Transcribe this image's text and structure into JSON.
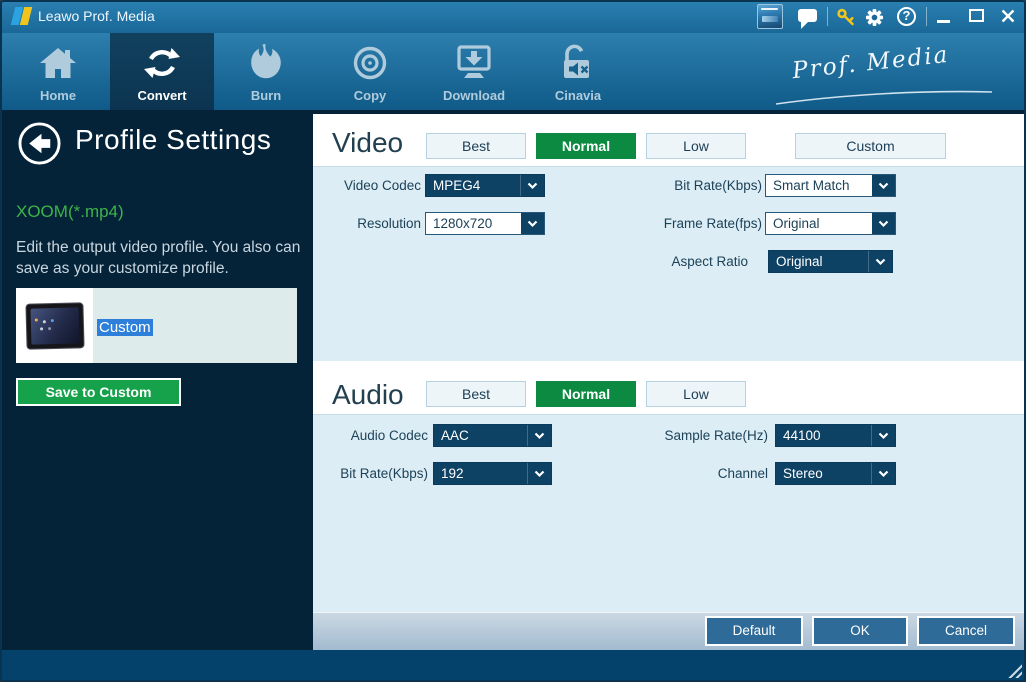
{
  "titlebar": {
    "title": "Leawo Prof. Media"
  },
  "brand": {
    "script": "Prof. Media"
  },
  "nav": {
    "selected": "Convert",
    "tabs": [
      {
        "label": "Home"
      },
      {
        "label": "Convert"
      },
      {
        "label": "Burn"
      },
      {
        "label": "Copy"
      },
      {
        "label": "Download"
      },
      {
        "label": "Cinavia"
      }
    ]
  },
  "sidebar": {
    "title": "Profile Settings",
    "profile_name": "XOOM(*.mp4)",
    "description_lines": [
      "Edit the output video profile. You also can",
      "save as your customize profile."
    ],
    "custom_item": {
      "label": "Custom"
    },
    "save_button_label": "Save to Custom"
  },
  "video": {
    "section_title": "Video",
    "quality": {
      "best": "Best",
      "normal": "Normal",
      "low": "Low",
      "custom": "Custom",
      "selected": "Normal"
    },
    "fields": {
      "video_codec": {
        "label": "Video Codec",
        "value": "MPEG4"
      },
      "bit_rate": {
        "label": "Bit Rate(Kbps)",
        "value": "Smart Match"
      },
      "resolution": {
        "label": "Resolution",
        "value": "1280x720"
      },
      "frame_rate": {
        "label": "Frame Rate(fps)",
        "value": "Original"
      },
      "aspect_ratio": {
        "label": "Aspect Ratio",
        "value": "Original"
      }
    }
  },
  "audio": {
    "section_title": "Audio",
    "quality": {
      "best": "Best",
      "normal": "Normal",
      "low": "Low",
      "selected": "Normal"
    },
    "fields": {
      "audio_codec": {
        "label": "Audio Codec",
        "value": "AAC"
      },
      "sample_rate": {
        "label": "Sample Rate(Hz)",
        "value": "44100"
      },
      "bit_rate": {
        "label": "Bit Rate(Kbps)",
        "value": "192"
      },
      "channel": {
        "label": "Channel",
        "value": "Stereo"
      }
    }
  },
  "footer": {
    "default_label": "Default",
    "ok_label": "OK",
    "cancel_label": "Cancel"
  },
  "colors": {
    "accent_green": "#0c8a41",
    "brand_green": "#16a24a",
    "profile_name_green": "#3cb549",
    "navy_control": "#0d4265",
    "selection_blue": "#2e7fd9",
    "status_bar": "#05426b"
  }
}
